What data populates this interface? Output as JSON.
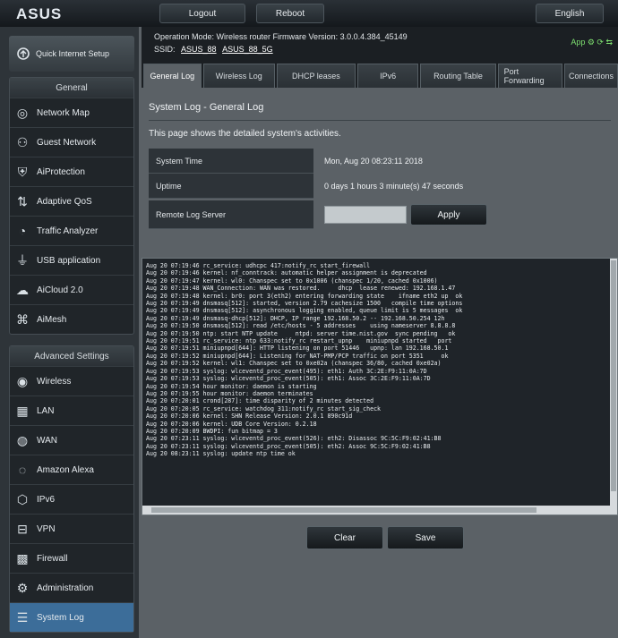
{
  "brand": {
    "logo": "ASUS"
  },
  "topbar": {
    "logout_label": "Logout",
    "reboot_label": "Reboot",
    "language_label": "English"
  },
  "sidebar": {
    "quick_setup_label": "Quick Internet Setup",
    "general_title": "General",
    "general_items": [
      {
        "label": "Network Map",
        "icon": "network-map-icon"
      },
      {
        "label": "Guest Network",
        "icon": "guest-network-icon"
      },
      {
        "label": "AiProtection",
        "icon": "aiprotection-icon"
      },
      {
        "label": "Adaptive QoS",
        "icon": "qos-icon"
      },
      {
        "label": "Traffic Analyzer",
        "icon": "traffic-analyzer-icon"
      },
      {
        "label": "USB application",
        "icon": "usb-icon"
      },
      {
        "label": "AiCloud 2.0",
        "icon": "aicloud-icon"
      },
      {
        "label": "AiMesh",
        "icon": "aimesh-icon"
      }
    ],
    "advanced_title": "Advanced Settings",
    "advanced_items": [
      {
        "label": "Wireless",
        "icon": "wireless-icon"
      },
      {
        "label": "LAN",
        "icon": "lan-icon"
      },
      {
        "label": "WAN",
        "icon": "wan-icon"
      },
      {
        "label": "Amazon Alexa",
        "icon": "alexa-icon"
      },
      {
        "label": "IPv6",
        "icon": "ipv6-icon"
      },
      {
        "label": "VPN",
        "icon": "vpn-icon"
      },
      {
        "label": "Firewall",
        "icon": "firewall-icon"
      },
      {
        "label": "Administration",
        "icon": "administration-icon"
      },
      {
        "label": "System Log",
        "icon": "system-log-icon"
      }
    ]
  },
  "status": {
    "line1": "Operation Mode: Wireless router  Firmware Version: 3.0.0.4.384_45149",
    "ssid_label": "SSID:",
    "ssid_values": [
      "ASUS_88",
      "ASUS_88_5G"
    ],
    "right_text": "App  ⚙  ⟳  ⇆"
  },
  "tabs": [
    "General Log",
    "Wireless Log",
    "DHCP leases",
    "IPv6",
    "Routing Table",
    "Port Forwarding",
    "Connections"
  ],
  "page": {
    "title": "System Log - General Log",
    "description": "This page shows the detailed system's activities.",
    "rows": [
      {
        "label": "System Time",
        "value": "Mon, Aug 20 08:23:11 2018"
      },
      {
        "label": "Uptime",
        "value": "0 days 1 hours 3 minute(s) 47 seconds"
      }
    ],
    "remote_label": "Remote Log Server",
    "remote_value": "",
    "apply_label": "Apply",
    "clear_label": "Clear",
    "save_label": "Save"
  },
  "log_lines": [
    "Aug 20 07:19:46 rc_service: udhcpc 417:notify_rc start_firewall",
    "Aug 20 07:19:46 kernel: nf_conntrack: automatic helper assignment is deprecated",
    "Aug 20 07:19:47 kernel: wl0: Chanspec set to 0x1006 (chanspec 1/20, cached 0x1006)",
    "Aug 20 07:19:48 WAN_Connection: WAN was restored.     dhcp  lease renewed: 192.168.1.47",
    "Aug 20 07:19:48 kernel: br0: port 3(eth2) entering forwarding state    ifname eth2 up  ok",
    "Aug 20 07:19:49 dnsmasq[512]: started, version 2.79 cachesize 1500   compile time options",
    "Aug 20 07:19:49 dnsmasq[512]: asynchronous logging enabled, queue limit is 5 messages  ok",
    "Aug 20 07:19:49 dnsmasq-dhcp[512]: DHCP, IP range 192.168.50.2 -- 192.168.50.254 12h",
    "Aug 20 07:19:50 dnsmasq[512]: read /etc/hosts - 5 addresses    using nameserver 8.8.8.8",
    "Aug 20 07:19:50 ntp: start NTP update     ntpd: server time.nist.gov  sync pending   ok",
    "Aug 20 07:19:51 rc_service: ntp 633:notify_rc restart_upnp    miniupnpd started   port",
    "Aug 20 07:19:51 miniupnpd[644]: HTTP listening on port 51446   upnp: lan 192.168.50.1",
    "Aug 20 07:19:52 miniupnpd[644]: Listening for NAT-PMP/PCP traffic on port 5351     ok",
    "Aug 20 07:19:52 kernel: wl1: Chanspec set to 0xe02a (chanspec 36/80, cached 0xe02a)",
    "Aug 20 07:19:53 syslog: wlceventd_proc_event(495): eth1: Auth 3C:2E:F9:11:0A:7D",
    "Aug 20 07:19:53 syslog: wlceventd_proc_event(505): eth1: Assoc 3C:2E:F9:11:0A:7D",
    "Aug 20 07:19:54 hour monitor: daemon is starting",
    "Aug 20 07:19:55 hour monitor: daemon terminates",
    "Aug 20 07:20:01 crond[287]: time disparity of 2 minutes detected",
    "Aug 20 07:20:05 rc_service: watchdog 311:notify_rc start_sig_check",
    "Aug 20 07:20:06 kernel: SHN Release Version: 2.0.1 890c91d",
    "Aug 20 07:20:06 kernel: UDB Core Version: 0.2.18",
    "Aug 20 07:20:09 BWDPI: fun bitmap = 3",
    "Aug 20 07:23:11 syslog: wlceventd_proc_event(526): eth2: Disassoc 9C:5C:F9:02:41:B8",
    "Aug 20 07:23:11 syslog: wlceventd_proc_event(505): eth2: Assoc 9C:5C:F9:02:41:B8",
    "Aug 20 08:23:11 syslog: update ntp time ok"
  ]
}
